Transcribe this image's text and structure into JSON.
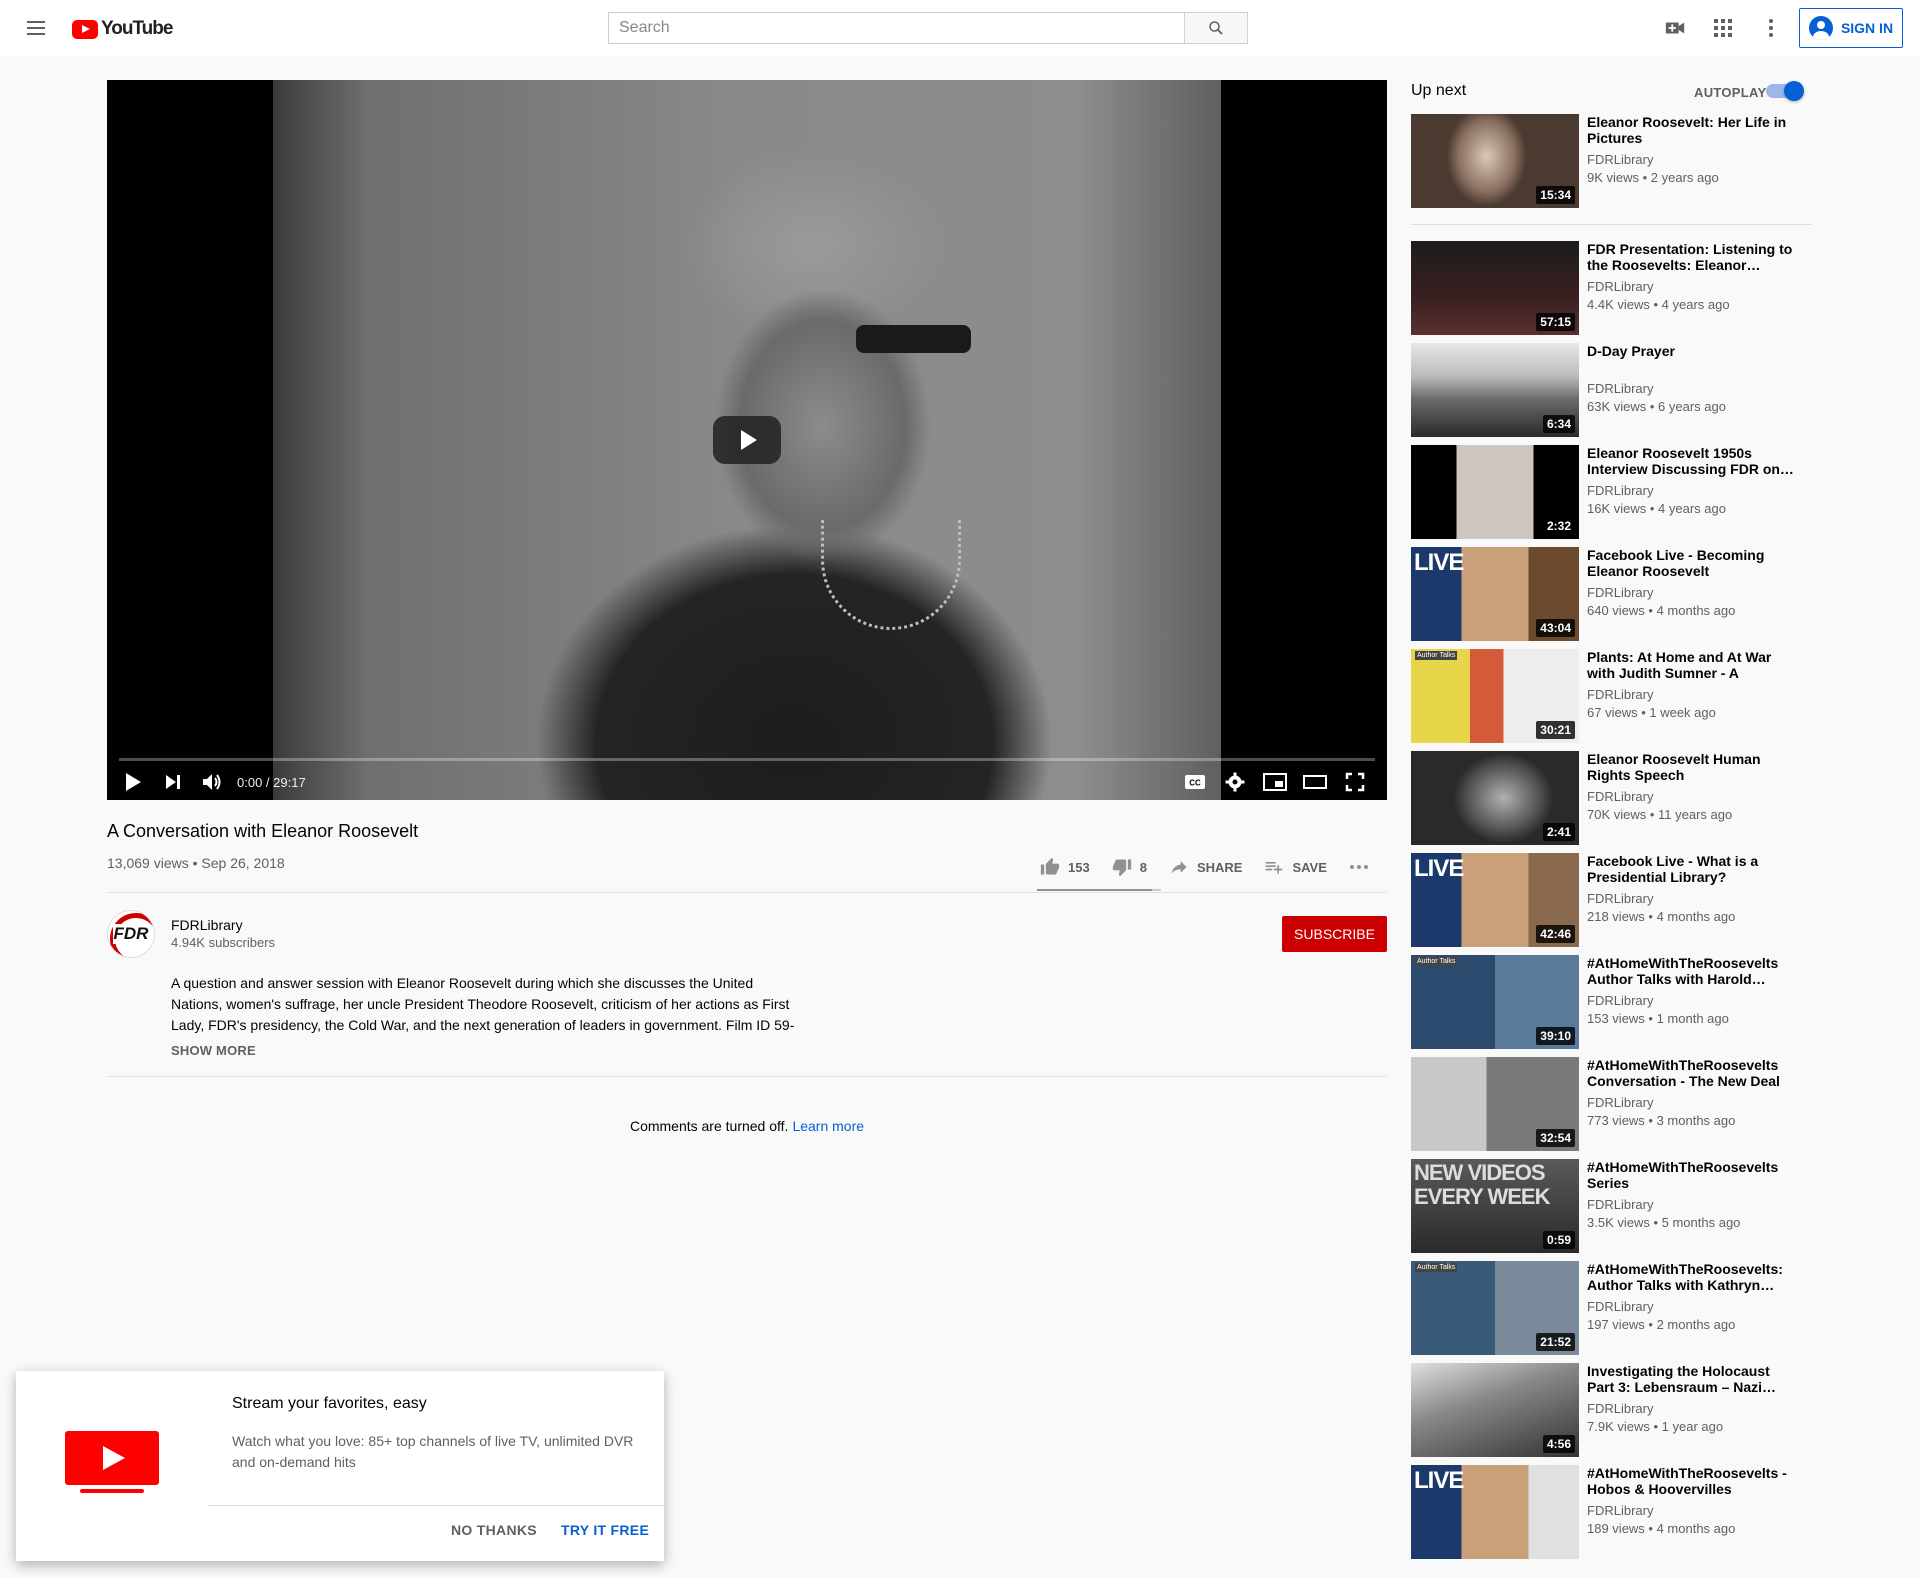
{
  "header": {
    "logo_text": "YouTube",
    "search_placeholder": "Search",
    "signin_label": "SIGN IN"
  },
  "player": {
    "time": "0:00 / 29:17",
    "progress_fraction": 0.0
  },
  "video": {
    "title": "A Conversation with Eleanor Roosevelt",
    "views_date": "13,069 views • Sep 26, 2018",
    "likes": "153",
    "dislikes": "8",
    "share_label": "SHARE",
    "save_label": "SAVE",
    "like_fraction": 0.95
  },
  "channel": {
    "name": "FDRLibrary",
    "subscribers": "4.94K subscribers",
    "avatar_text": "FDR",
    "subscribe_label": "SUBSCRIBE"
  },
  "description": {
    "text": "A question and answer session with Eleanor Roosevelt during which she discusses the United Nations, women's suffrage, her uncle President Theodore Roosevelt, criticism of her actions as First Lady, FDR's presidency, the Cold War, and the next generation of leaders in government. Film ID 59-",
    "show_more": "SHOW MORE"
  },
  "comments": {
    "text": "Comments are turned off.",
    "link": "Learn more"
  },
  "sidebar": {
    "up_next_label": "Up next",
    "autoplay_label": "AUTOPLAY",
    "autoplay_on": true,
    "videos": [
      {
        "title": "Eleanor Roosevelt: Her Life in Pictures",
        "channel": "FDRLibrary",
        "meta": "9K views • 2 years ago",
        "duration": "15:34"
      },
      {
        "title": "FDR Presentation: Listening to the Roosevelts: Eleanor…",
        "channel": "FDRLibrary",
        "meta": "4.4K views • 4 years ago",
        "duration": "57:15"
      },
      {
        "title": "D-Day Prayer",
        "channel": "FDRLibrary",
        "meta": "63K views • 6 years ago",
        "duration": "6:34"
      },
      {
        "title": "Eleanor Roosevelt 1950s Interview Discussing FDR on…",
        "channel": "FDRLibrary",
        "meta": "16K views • 4 years ago",
        "duration": "2:32"
      },
      {
        "title": "Facebook Live - Becoming Eleanor Roosevelt",
        "channel": "FDRLibrary",
        "meta": "640 views • 4 months ago",
        "duration": "43:04",
        "thumb_text": "LIVE"
      },
      {
        "title": "Plants: At Home and At War with Judith Sumner - A Virtual…",
        "channel": "FDRLibrary",
        "meta": "67 views • 1 week ago",
        "duration": "30:21",
        "thumb_text": "Author Talks"
      },
      {
        "title": "Eleanor Roosevelt Human Rights Speech",
        "channel": "FDRLibrary",
        "meta": "70K views • 11 years ago",
        "duration": "2:41"
      },
      {
        "title": "Facebook Live - What is a Presidential Library?",
        "channel": "FDRLibrary",
        "meta": "218 views • 4 months ago",
        "duration": "42:46",
        "thumb_text": "LIVE"
      },
      {
        "title": "#AtHomeWithTheRoosevelts Author Talks with Harold…",
        "channel": "FDRLibrary",
        "meta": "153 views • 1 month ago",
        "duration": "39:10",
        "thumb_text": "Author Talks"
      },
      {
        "title": "#AtHomeWithTheRoosevelts Conversation - The New Deal t…",
        "channel": "FDRLibrary",
        "meta": "773 views • 3 months ago",
        "duration": "32:54"
      },
      {
        "title": "#AtHomeWithTheRoosevelts Series",
        "channel": "FDRLibrary",
        "meta": "3.5K views • 5 months ago",
        "duration": "0:59",
        "thumb_text": "NEW VIDEOS EVERY WEEK"
      },
      {
        "title": "#AtHomeWithTheRoosevelts: Author Talks with Kathryn…",
        "channel": "FDRLibrary",
        "meta": "197 views • 2 months ago",
        "duration": "21:52",
        "thumb_text": "Author Talks"
      },
      {
        "title": "Investigating the Holocaust Part 3: Lebensraum – Nazi…",
        "channel": "FDRLibrary",
        "meta": "7.9K views • 1 year ago",
        "duration": "4:56"
      },
      {
        "title": "#AtHomeWithTheRoosevelts - Hobos & Hoovervilles",
        "channel": "FDRLibrary",
        "meta": "189 views • 4 months ago",
        "duration": "",
        "thumb_text": "LIVE"
      }
    ]
  },
  "promo": {
    "title": "Stream your favorites, easy",
    "body": "Watch what you love: 85+ top channels of live TV, unlimited DVR and on-demand hits",
    "no_thanks": "NO THANKS",
    "try_free": "TRY IT FREE"
  },
  "colors": {
    "brand_red": "#ff0000",
    "subscribe_red": "#cc0000",
    "link_blue": "#065fd4"
  }
}
